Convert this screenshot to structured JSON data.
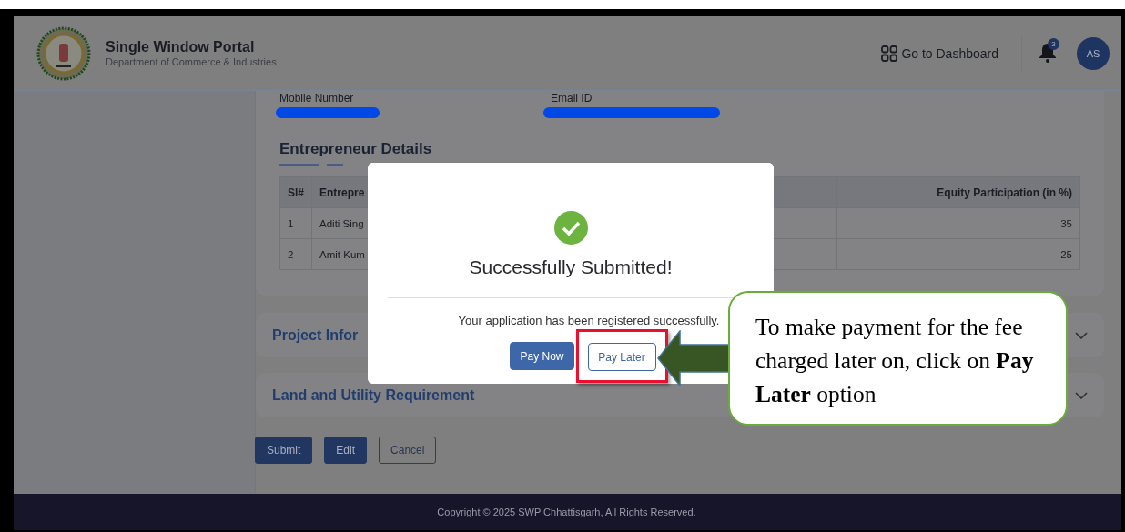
{
  "header": {
    "title": "Single Window Portal",
    "subtitle": "Department of Commerce & Industries",
    "dashboard_link": "Go to Dashboard",
    "notification_count": "3",
    "avatar_initials": "AS"
  },
  "contact": {
    "fields": [
      {
        "label": "Mobile Number",
        "redacted": true
      },
      {
        "label": "Email ID",
        "redacted": true
      }
    ]
  },
  "entrepreneur": {
    "title": "Entrepreneur Details",
    "table": {
      "columns": [
        "Sl#",
        "Entrepre",
        "Equity Participation (in %)"
      ],
      "rows": [
        [
          "1",
          "Aditi Sing",
          "35"
        ],
        [
          "2",
          "Amit Kum",
          "25"
        ]
      ]
    }
  },
  "sections": [
    {
      "title": "Project Infor",
      "expanded": false
    },
    {
      "title": "Land and Utility Requirement",
      "expanded": false
    }
  ],
  "actions": [
    {
      "label": "Submit",
      "kind": "primary"
    },
    {
      "label": "Edit",
      "kind": "primary"
    },
    {
      "label": "Cancel",
      "kind": "outline"
    }
  ],
  "modal": {
    "title": "Successfully Submitted!",
    "message": "Your application has been registered successfully.",
    "buttons": [
      {
        "label": "Pay Now",
        "kind": "primary",
        "highlighted": false
      },
      {
        "label": "Pay Later",
        "kind": "outline",
        "highlighted": true
      }
    ]
  },
  "callout": {
    "text": "To make payment for the fee charged later on, click on **Pay Later** option"
  },
  "footer": {
    "copyright": "Copyright © 2025 SWP Chhattisgarh, All Rights Reserved."
  }
}
